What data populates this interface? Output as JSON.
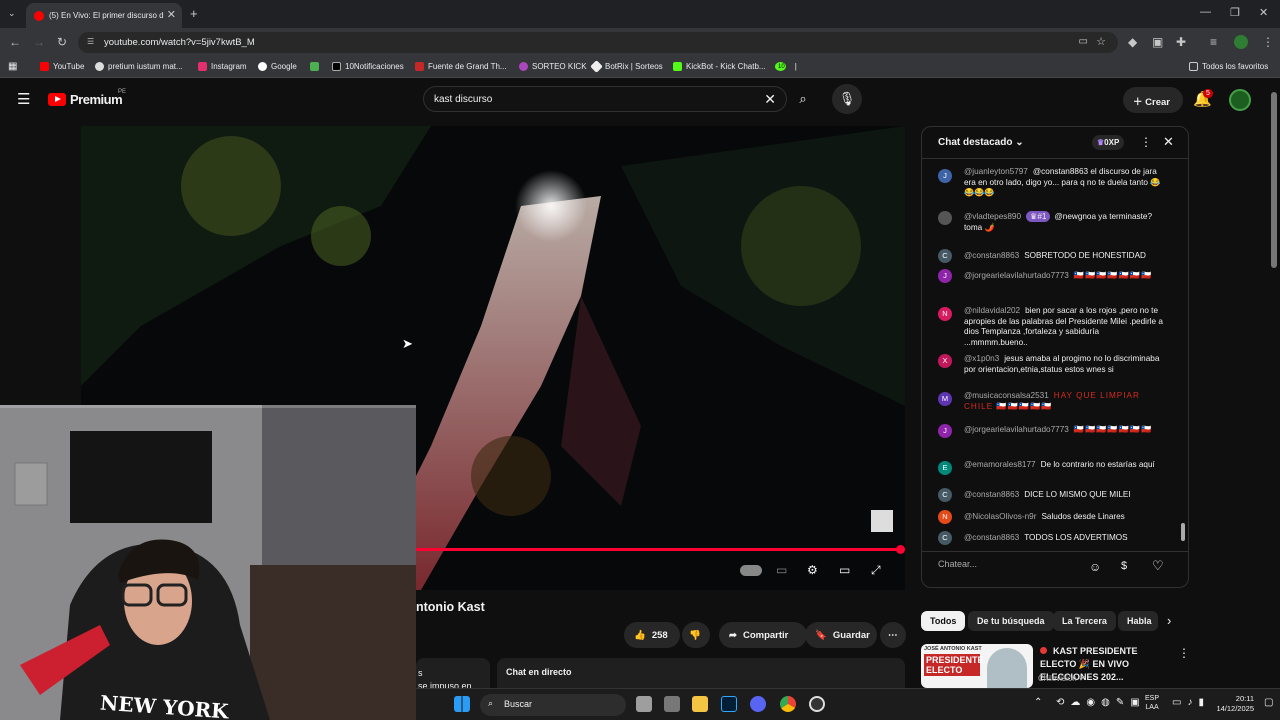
{
  "browser": {
    "tab_title": "(5) En Vivo: El primer discurso d",
    "url": "youtube.com/watch?v=5jiv7kwtB_M",
    "bookmarks": [
      "YouTube",
      "pretium iustum mat...",
      "Instagram",
      "Google",
      "10Notificaciones",
      "Fuente de Grand Th...",
      "SORTEO KICK",
      "BotRix | Sorteos",
      "KickBot - Kick Chatb...",
      "10",
      "Todos los favoritos"
    ]
  },
  "yt": {
    "logo": "Premium",
    "region": "PE",
    "search_value": "kast discurso",
    "create_label": "Crear",
    "notif_count": "5"
  },
  "video": {
    "title": "ntonio Kast",
    "likes": "258",
    "share_label": "Compartir",
    "save_label": "Guardar",
    "side_text_1": "s",
    "side_text_2": "se impuso en",
    "live_chat_label": "Chat en directo",
    "progress": 1.0
  },
  "chat": {
    "header": "Chat destacado",
    "xp": "0XP",
    "badge": "#1",
    "input_placeholder": "Chatear...",
    "messages": [
      {
        "initial": "J",
        "color": "#3e64a8",
        "user": "@juanleyton5797",
        "text": "@constan8863 el discurso de jara era en otro lado, digo yo... para q no te duela tanto 😂😂😂😂"
      },
      {
        "initial": "",
        "color": "#555555",
        "user": "@vladtepes890",
        "text": "@newgnoa ya terminaste? toma 🌶️"
      },
      {
        "initial": "C",
        "color": "#455a64",
        "user": "@constan8863",
        "text": "SOBRETODO DE HONESTIDAD"
      },
      {
        "initial": "J",
        "color": "#8e24aa",
        "user": "@jorgearielavilahurtado7773",
        "text": "🇨🇱🇨🇱🇨🇱🇨🇱🇨🇱🇨🇱🇨🇱"
      },
      {
        "initial": "N",
        "color": "#d81b60",
        "user": "@nildavidal202",
        "text": "bien por sacar a los rojos ,pero no te apropies de las palabras del Presidente Milei .pedirle a dios Templanza ,fortaleza y sabiduría ...mmmm.bueno.."
      },
      {
        "initial": "X",
        "color": "#c2185b",
        "user": "@x1p0n3",
        "text": "jesus amaba al progimo no lo discriminaba por orientacion,etnia,status estos wnes si"
      },
      {
        "initial": "M",
        "color": "#5e35b1",
        "user": "@musicaconsalsa2531",
        "text": "HAY QUE LIMPIAR CHILE 🇨🇱🇨🇱🇨🇱🇨🇱🇨🇱"
      },
      {
        "initial": "J",
        "color": "#8e24aa",
        "user": "@jorgearielavilahurtado7773",
        "text": "🇨🇱🇨🇱🇨🇱🇨🇱🇨🇱🇨🇱🇨🇱"
      },
      {
        "initial": "E",
        "color": "#00897b",
        "user": "@emamorales8177",
        "text": "De lo contrario no estarías aquí"
      },
      {
        "initial": "C",
        "color": "#455a64",
        "user": "@constan8863",
        "text": "DICE LO MISMO QUE MILEI"
      },
      {
        "initial": "N",
        "color": "#e64a19",
        "user": "@NicolasOlivos-n9r",
        "text": "Saludos desde Linares"
      },
      {
        "initial": "C",
        "color": "#455a64",
        "user": "@constan8863",
        "text": "TODOS LOS ADVERTIMOS"
      }
    ]
  },
  "chips": [
    "Todos",
    "De tu búsqueda",
    "La Tercera",
    "Habla"
  ],
  "related": {
    "title": "KAST PRESIDENTE ELECTO 🎉 EN VIVO ELECCIONES 202...",
    "channel": "Chilevisión",
    "thumb_top": "JOSÉ ANTONIO KAST",
    "thumb_main": "PRESIDENTE ELECTO"
  },
  "webcam": {
    "shirt_text": "NEW YORK"
  },
  "taskbar": {
    "search_label": "Buscar",
    "lang1": "ESP",
    "lang2": "LAA",
    "time": "20:11",
    "date": "14/12/2025"
  },
  "colors": {
    "accent_red": "#ff0033",
    "chip_active_bg": "#f1f1f1"
  }
}
